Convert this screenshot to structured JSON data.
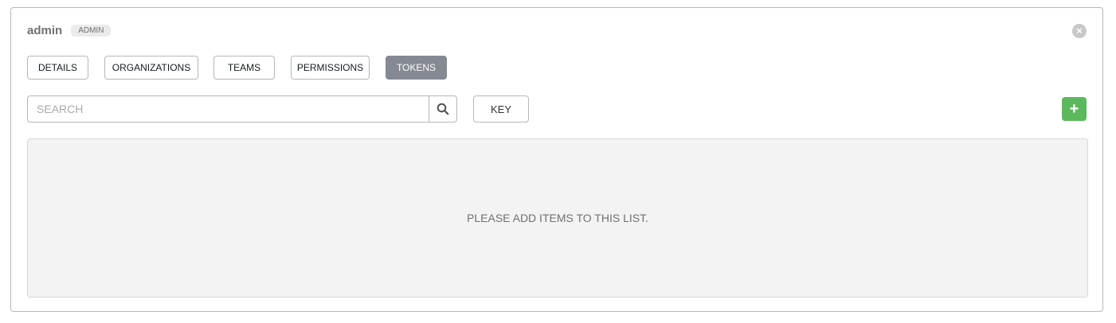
{
  "header": {
    "title": "admin",
    "badge": "ADMIN"
  },
  "tabs": [
    {
      "label": "DETAILS",
      "active": false
    },
    {
      "label": "ORGANIZATIONS",
      "active": false
    },
    {
      "label": "TEAMS",
      "active": false
    },
    {
      "label": "PERMISSIONS",
      "active": false
    },
    {
      "label": "TOKENS",
      "active": true
    }
  ],
  "search": {
    "placeholder": "SEARCH",
    "value": ""
  },
  "toolbar": {
    "key_label": "KEY",
    "add_label": "+"
  },
  "list": {
    "empty_message": "PLEASE ADD ITEMS TO THIS LIST."
  },
  "colors": {
    "active_tab": "#848992",
    "add_button": "#5cb85c",
    "empty_list_bg": "#f3f3f3"
  },
  "icons": {
    "close": "close-icon",
    "search": "search-icon",
    "add": "plus-icon"
  }
}
